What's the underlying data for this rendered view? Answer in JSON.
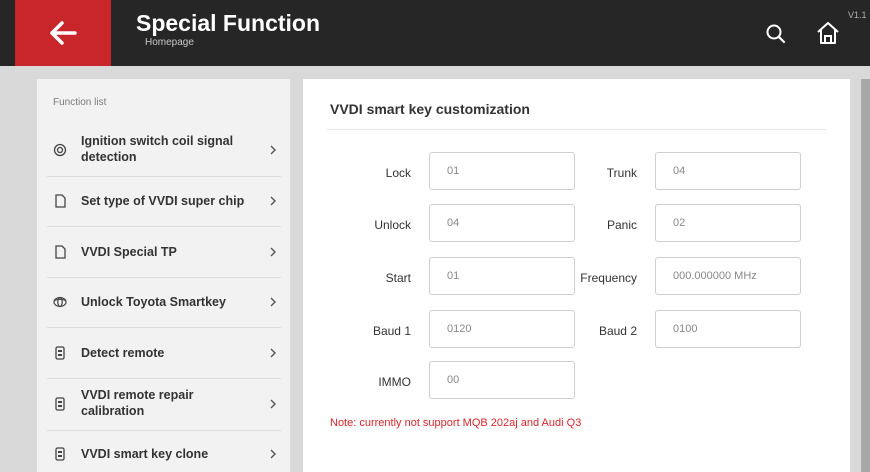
{
  "header": {
    "title": "Special Function",
    "subtitle": "Homepage",
    "version": "V1.1",
    "back_icon": "arrow-left-icon",
    "search_icon": "search-icon",
    "home_icon": "home-icon"
  },
  "sidebar": {
    "heading": "Function list",
    "items": [
      {
        "label": "Ignition switch coil signal detection",
        "icon": "coil-icon"
      },
      {
        "label": "Set type of VVDI super chip",
        "icon": "chip-icon"
      },
      {
        "label": "VVDI Special TP",
        "icon": "chip-icon"
      },
      {
        "label": "Unlock Toyota Smartkey",
        "icon": "toyota-icon"
      },
      {
        "label": "Detect remote",
        "icon": "remote-icon"
      },
      {
        "label": "VVDI remote repair calibration",
        "icon": "remote-icon"
      },
      {
        "label": "VVDI smart key clone",
        "icon": "remote-icon"
      }
    ]
  },
  "main": {
    "title": "VVDI smart key customization",
    "fields": {
      "lock": {
        "label": "Lock",
        "value": "01"
      },
      "trunk": {
        "label": "Trunk",
        "value": "04"
      },
      "unlock": {
        "label": "Unlock",
        "value": "04"
      },
      "panic": {
        "label": "Panic",
        "value": "02"
      },
      "start": {
        "label": "Start",
        "value": "01"
      },
      "frequency": {
        "label": "Frequency",
        "value": "000.000000 MHz"
      },
      "baud1": {
        "label": "Baud 1",
        "value": "0120"
      },
      "baud2": {
        "label": "Baud 2",
        "value": "0100"
      },
      "immo": {
        "label": "IMMO",
        "value": "00"
      }
    },
    "note": "Note: currently not support MQB 202aj and Audi Q3"
  },
  "colors": {
    "accent_red": "#c9262c",
    "topbar": "#262626",
    "note_red": "#d9262c"
  }
}
